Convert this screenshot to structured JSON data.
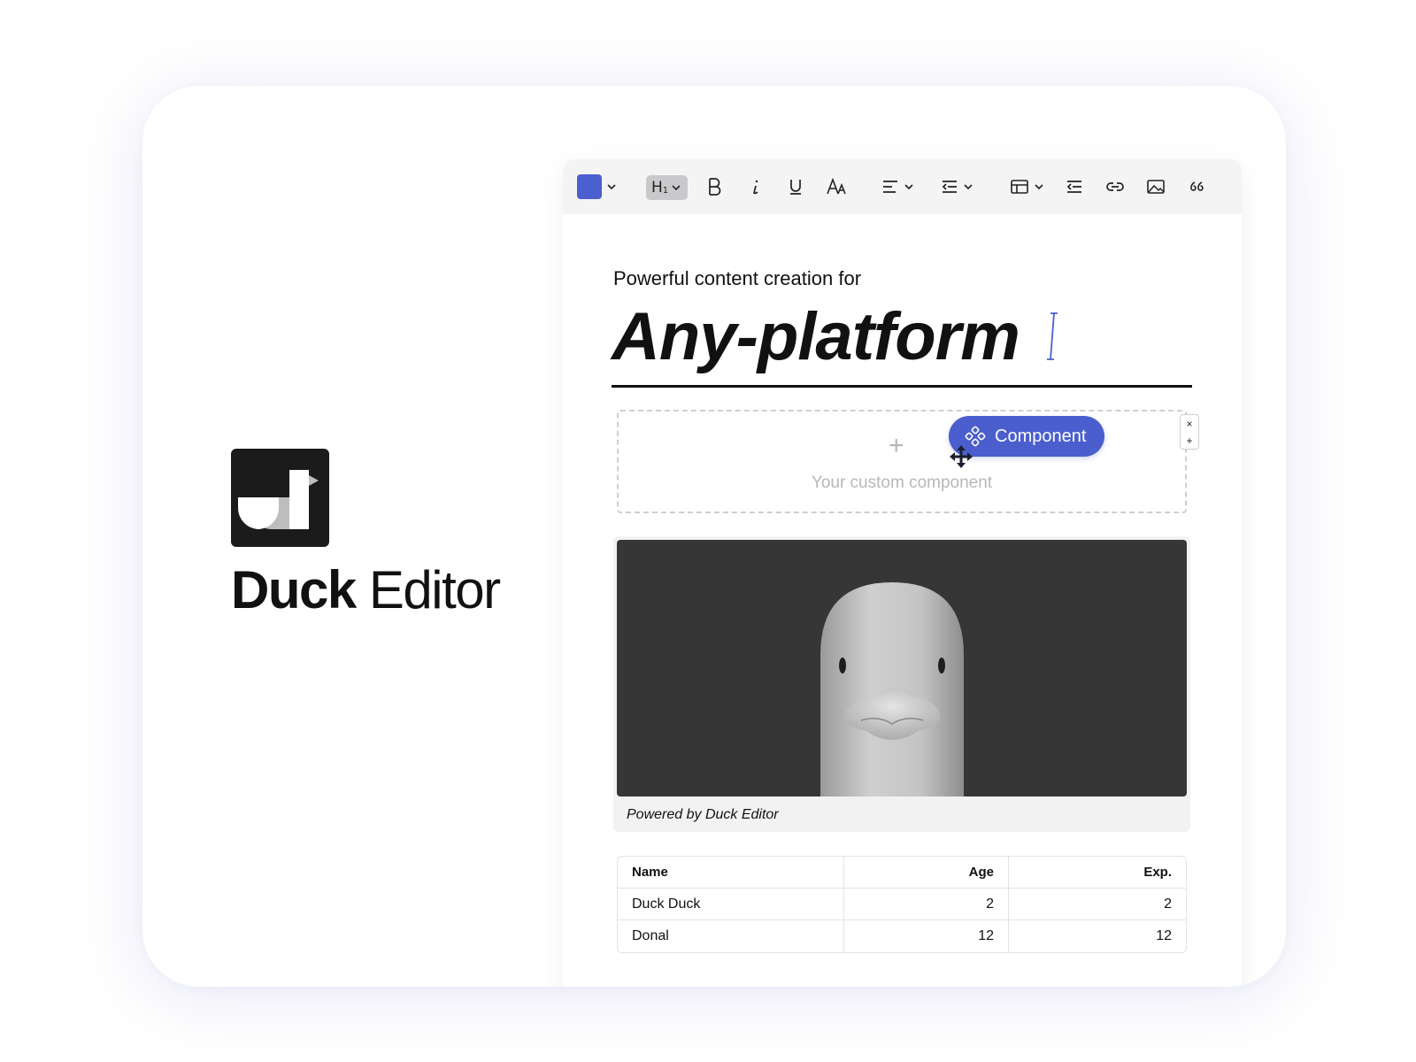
{
  "brand": {
    "name_bold": "Duck",
    "name_regular": "Editor"
  },
  "colors": {
    "accent": "#4a5fcd",
    "toolbar_bg": "#f4f4f5",
    "image_bg": "#363636"
  },
  "toolbar": {
    "text_color_swatch": "#4b5fcf",
    "heading_label": "H",
    "heading_level": "1",
    "items": [
      "color-picker",
      "heading-dropdown",
      "bold",
      "italic",
      "underline",
      "font-size",
      "align-dropdown",
      "indent-dropdown",
      "table-dropdown",
      "outdent",
      "link",
      "image",
      "quote"
    ]
  },
  "content": {
    "subtitle": "Powerful content creation for",
    "headline": "Any-platform",
    "dropzone_plus": "+",
    "dropzone_text": "Your custom component",
    "component_label": "Component",
    "side_close": "×",
    "side_add": "+",
    "image_caption": "Powered by Duck Editor"
  },
  "table": {
    "headers": [
      "Name",
      "Age",
      "Exp."
    ],
    "rows": [
      [
        "Duck Duck",
        "2",
        "2"
      ],
      [
        "Donal",
        "12",
        "12"
      ]
    ]
  }
}
